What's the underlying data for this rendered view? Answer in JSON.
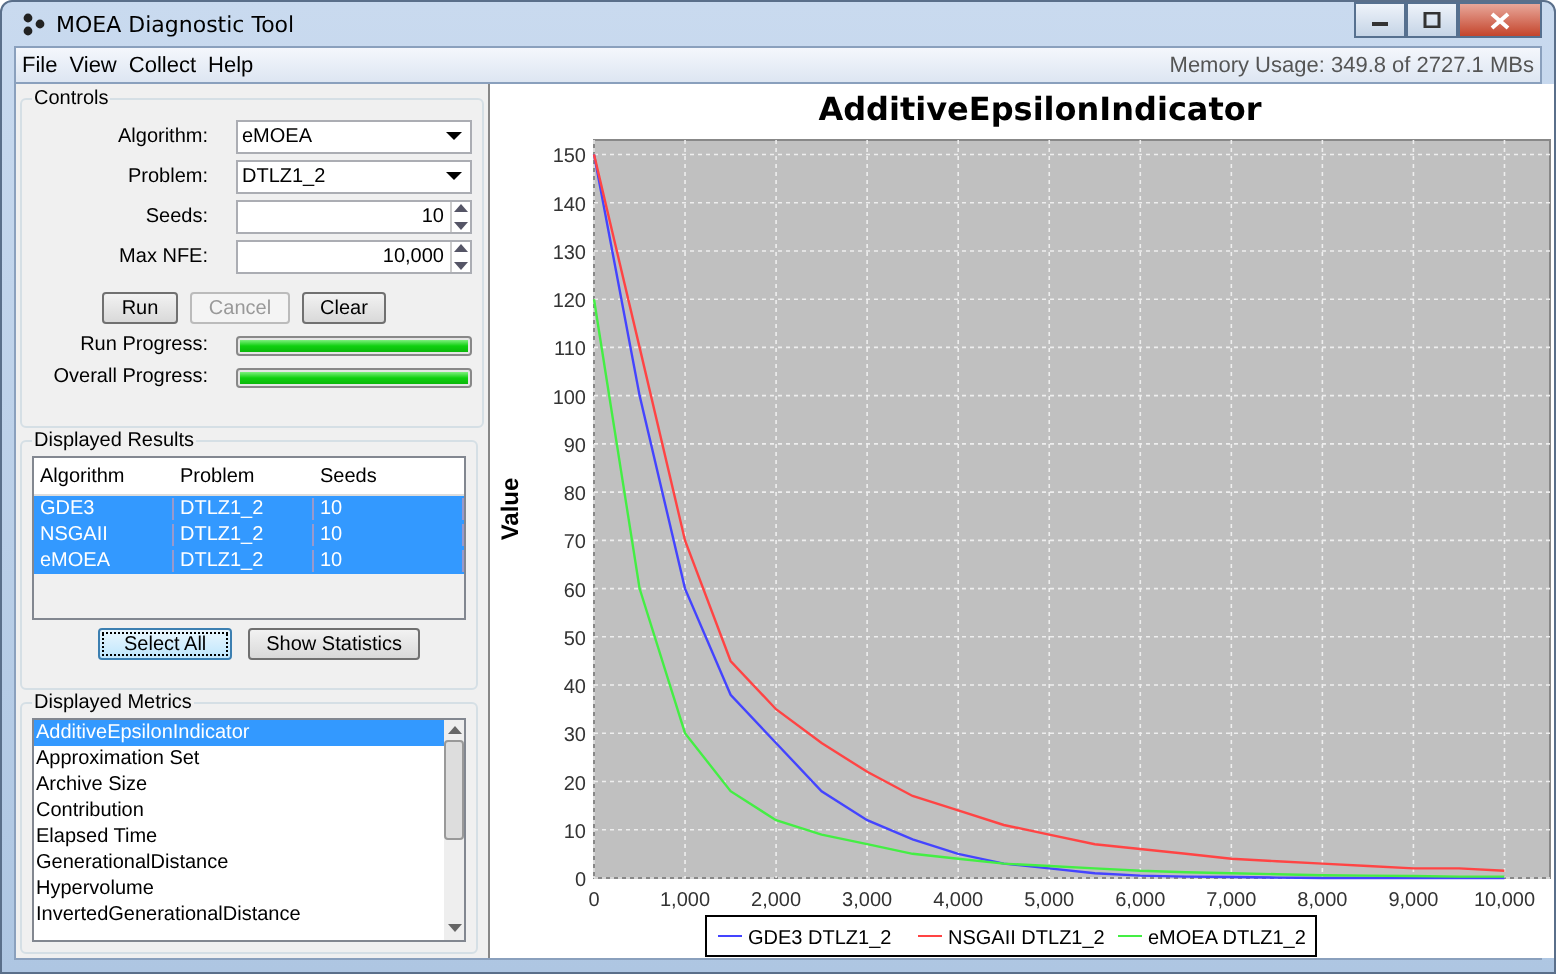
{
  "window": {
    "title": "MOEA Diagnostic Tool"
  },
  "menu": [
    "File",
    "View",
    "Collect",
    "Help"
  ],
  "memory_usage": "Memory Usage: 349.8 of 2727.1 MBs",
  "controls": {
    "title": "Controls",
    "fields": [
      {
        "kind": "dropdown",
        "label": "Algorithm:",
        "value": "eMOEA"
      },
      {
        "kind": "dropdown",
        "label": "Problem:",
        "value": "DTLZ1_2"
      },
      {
        "kind": "spinner",
        "label": "Seeds:",
        "value": "10"
      },
      {
        "kind": "spinner",
        "label": "Max NFE:",
        "value": "10,000"
      }
    ],
    "buttons": [
      {
        "label": "Run",
        "disabled": false
      },
      {
        "label": "Cancel",
        "disabled": true
      },
      {
        "label": "Clear",
        "disabled": false
      }
    ],
    "progress": [
      {
        "label": "Run Progress:",
        "level": 1
      },
      {
        "label": "Overall Progress:",
        "level": 1
      }
    ]
  },
  "results": {
    "title": "Displayed Results",
    "columns": [
      "Algorithm",
      "Problem",
      "Seeds"
    ],
    "rows": [
      {
        "cells": [
          "GDE3",
          "DTLZ1_2",
          "10"
        ],
        "selected": true
      },
      {
        "cells": [
          "NSGAII",
          "DTLZ1_2",
          "10"
        ],
        "selected": true
      },
      {
        "cells": [
          "eMOEA",
          "DTLZ1_2",
          "10"
        ],
        "selected": true
      }
    ],
    "buttons": [
      "Select All",
      "Show Statistics"
    ]
  },
  "metrics": {
    "title": "Displayed Metrics",
    "items": [
      {
        "label": "AdditiveEpsilonIndicator",
        "selected": true
      },
      {
        "label": "Approximation Set",
        "selected": false
      },
      {
        "label": "Archive Size",
        "selected": false
      },
      {
        "label": "Contribution",
        "selected": false
      },
      {
        "label": "Elapsed Time",
        "selected": false
      },
      {
        "label": "GenerationalDistance",
        "selected": false
      },
      {
        "label": "Hypervolume",
        "selected": false
      },
      {
        "label": "InvertedGenerationalDistance",
        "selected": false
      }
    ]
  },
  "chart_data": {
    "type": "line",
    "title": "AdditiveEpsilonIndicator",
    "ylabel": "Value",
    "x": [
      0,
      500,
      1000,
      1500,
      2000,
      2500,
      3000,
      3500,
      4000,
      4500,
      5000,
      5500,
      6000,
      6500,
      7000,
      7500,
      8000,
      8500,
      9000,
      9500,
      10000
    ],
    "series": [
      {
        "name": "GDE3 DTLZ1_2",
        "color": "#4444ff",
        "values": [
          150,
          100,
          60,
          38,
          28,
          18,
          12,
          8,
          5,
          3,
          2,
          1,
          0.5,
          0.3,
          0.2,
          0.1,
          0,
          0,
          0,
          0,
          0
        ]
      },
      {
        "name": "NSGAII DTLZ1_2",
        "color": "#ff4444",
        "values": [
          150,
          110,
          70,
          45,
          35,
          28,
          22,
          17,
          14,
          11,
          9,
          7,
          6,
          5,
          4,
          3.5,
          3,
          2.5,
          2,
          2,
          1.5
        ]
      },
      {
        "name": "eMOEA DTLZ1_2",
        "color": "#44ee44",
        "values": [
          120,
          60,
          30,
          18,
          12,
          9,
          7,
          5,
          4,
          3,
          2.5,
          2,
          1.5,
          1.2,
          1,
          0.8,
          0.6,
          0.5,
          0.4,
          0.3,
          0.3
        ]
      }
    ],
    "xlim": [
      0,
      10500
    ],
    "ylim": [
      0,
      153
    ],
    "xticks": [
      {
        "value": 0,
        "label": "0"
      },
      {
        "value": 1000,
        "label": "1,000"
      },
      {
        "value": 2000,
        "label": "2,000"
      },
      {
        "value": 3000,
        "label": "3,000"
      },
      {
        "value": 4000,
        "label": "4,000"
      },
      {
        "value": 5000,
        "label": "5,000"
      },
      {
        "value": 6000,
        "label": "6,000"
      },
      {
        "value": 7000,
        "label": "7,000"
      },
      {
        "value": 8000,
        "label": "8,000"
      },
      {
        "value": 9000,
        "label": "9,000"
      },
      {
        "value": 10000,
        "label": "10,000"
      }
    ],
    "yticks": [
      0,
      10,
      20,
      30,
      40,
      50,
      60,
      70,
      80,
      90,
      100,
      110,
      120,
      130,
      140,
      150
    ],
    "grid": true,
    "legend": true
  }
}
